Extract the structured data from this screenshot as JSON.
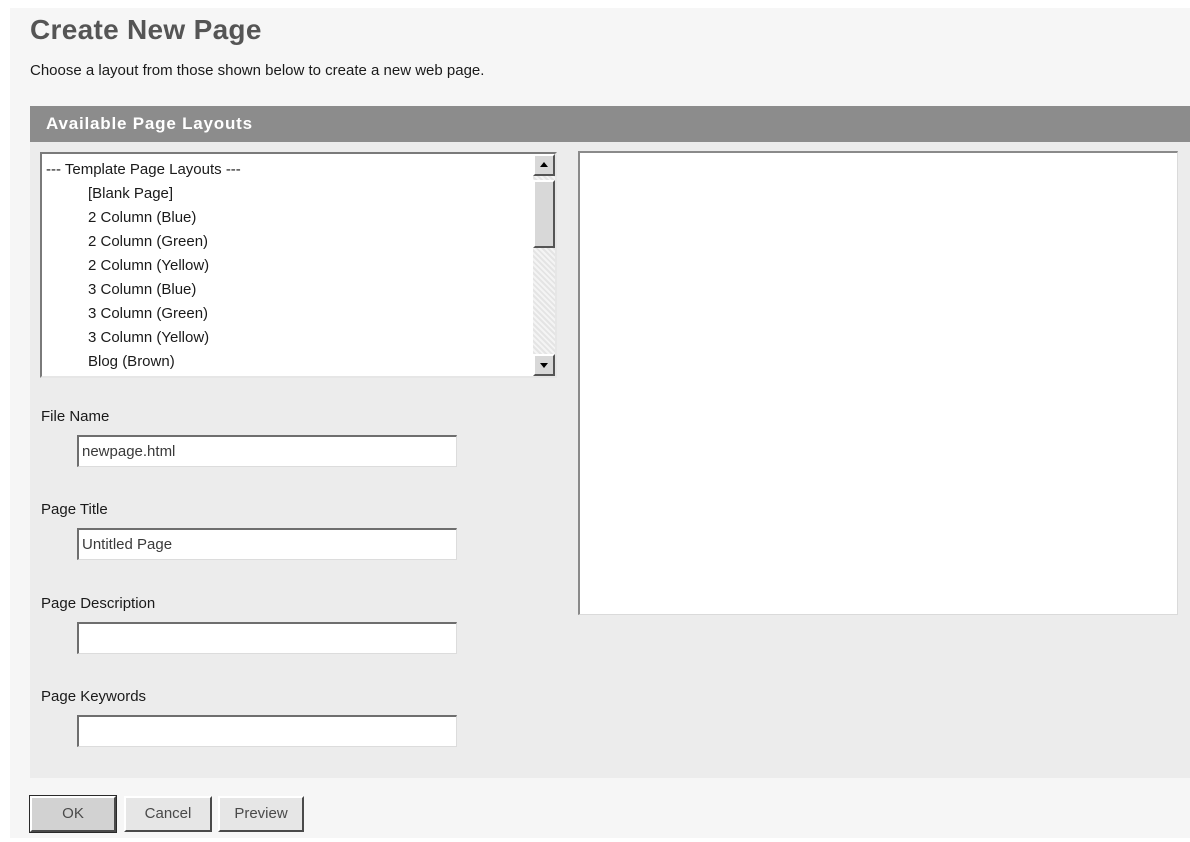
{
  "header": {
    "title": "Create New Page",
    "subtitle": "Choose a layout from those shown below to create a new web page."
  },
  "layouts_panel": {
    "heading": "Available Page Layouts",
    "list": {
      "items": [
        {
          "label": "--- Template Page Layouts ---",
          "indent": false
        },
        {
          "label": "[Blank Page]",
          "indent": true
        },
        {
          "label": "2 Column (Blue)",
          "indent": true
        },
        {
          "label": "2 Column (Green)",
          "indent": true
        },
        {
          "label": "2 Column (Yellow)",
          "indent": true
        },
        {
          "label": "3 Column (Blue)",
          "indent": true
        },
        {
          "label": "3 Column (Green)",
          "indent": true
        },
        {
          "label": "3 Column (Yellow)",
          "indent": true
        },
        {
          "label": "Blog (Brown)",
          "indent": true
        }
      ]
    }
  },
  "form": {
    "file_name": {
      "label": "File Name",
      "value": "newpage.html"
    },
    "page_title": {
      "label": "Page Title",
      "value": "Untitled Page"
    },
    "page_description": {
      "label": "Page Description",
      "value": ""
    },
    "page_keywords": {
      "label": "Page Keywords",
      "value": ""
    }
  },
  "buttons": {
    "ok": "OK",
    "cancel": "Cancel",
    "preview": "Preview"
  },
  "icons": {
    "scroll_up": "arrow-up-icon",
    "scroll_down": "arrow-down-icon"
  },
  "colors": {
    "panel_header_bg": "#8c8c8c",
    "panel_bg": "#ececec",
    "title_color": "#555555"
  }
}
